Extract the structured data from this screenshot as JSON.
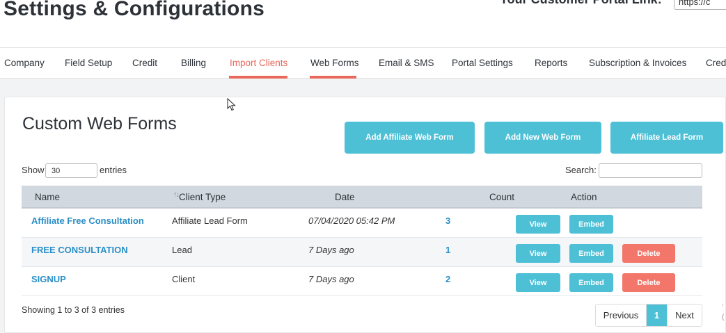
{
  "header": {
    "title": "Settings & Configurations",
    "portal_link_label": "Your Customer Portal Link:",
    "portal_link_value": "https://c"
  },
  "nav": {
    "items": [
      {
        "label": "Company"
      },
      {
        "label": "Field Setup"
      },
      {
        "label": "Credit"
      },
      {
        "label": "Billing"
      },
      {
        "label": "Import Clients"
      },
      {
        "label": "Web Forms"
      },
      {
        "label": "Email & SMS"
      },
      {
        "label": "Portal Settings"
      },
      {
        "label": "Reports"
      },
      {
        "label": "Subscription & Invoices"
      },
      {
        "label": "Cred"
      }
    ],
    "active": "Web Forms",
    "accent_color": "#e8695c"
  },
  "card": {
    "title": "Custom Web Forms",
    "buttons": {
      "add_affiliate": "Add Affiliate Web Form",
      "add_new": "Add New Web Form",
      "affiliate_lead": "Affiliate Lead Form"
    }
  },
  "table_controls": {
    "show_label": "Show",
    "show_value": "30",
    "entries_label": "entries",
    "search_label": "Search:",
    "search_value": ""
  },
  "table": {
    "headers": {
      "name": "Name",
      "client_type": "Client Type",
      "date": "Date",
      "count": "Count",
      "action": "Action"
    },
    "rows": [
      {
        "name": "Affiliate Free Consultation",
        "client_type": "Affiliate Lead Form",
        "date": "07/04/2020 05:42 PM",
        "count": "3",
        "view": "View",
        "embed": "Embed"
      },
      {
        "name": "FREE CONSULTATION",
        "client_type": "Lead",
        "date": "7 Days ago",
        "count": "1",
        "view": "View",
        "embed": "Embed",
        "delete": "Delete"
      },
      {
        "name": "SIGNUP",
        "client_type": "Client",
        "date": "7 Days ago",
        "count": "2",
        "view": "View",
        "embed": "Embed",
        "delete": "Delete"
      }
    ]
  },
  "footer": {
    "info": "Showing 1 to 3 of 3 entries",
    "previous": "Previous",
    "current_page": "1",
    "next": "Next"
  },
  "colors": {
    "primary": "#4ec0d6",
    "danger": "#f2776a",
    "link": "#2a8fc7",
    "table_header": "#d2d8df"
  }
}
